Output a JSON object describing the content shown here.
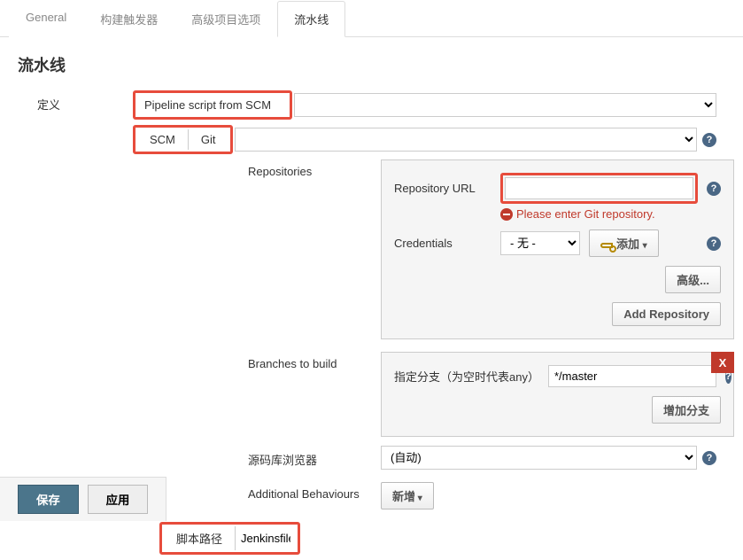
{
  "tabs": {
    "general": "General",
    "triggers": "构建触发器",
    "advanced": "高级项目选项",
    "pipeline": "流水线"
  },
  "section_title": "流水线",
  "definition": {
    "label": "定义",
    "value": "Pipeline script from SCM"
  },
  "scm": {
    "label": "SCM",
    "value": "Git"
  },
  "repositories": {
    "label": "Repositories",
    "repo_url_label": "Repository URL",
    "repo_url_value": "",
    "error": "Please enter Git repository.",
    "credentials_label": "Credentials",
    "credentials_value": "- 无 -",
    "add_label": "添加",
    "advanced_label": "高级...",
    "add_repo_label": "Add Repository"
  },
  "branches": {
    "label": "Branches to build",
    "spec_label": "指定分支（为空时代表any）",
    "spec_value": "*/master",
    "add_branch_label": "增加分支",
    "close": "X"
  },
  "browser": {
    "label": "源码库浏览器",
    "value": "(自动)"
  },
  "behaviours": {
    "label": "Additional Behaviours",
    "add_label": "新增"
  },
  "script_path": {
    "label": "脚本路径",
    "value": "Jenkinsfile"
  },
  "footer": {
    "save": "保存",
    "apply": "应用"
  }
}
